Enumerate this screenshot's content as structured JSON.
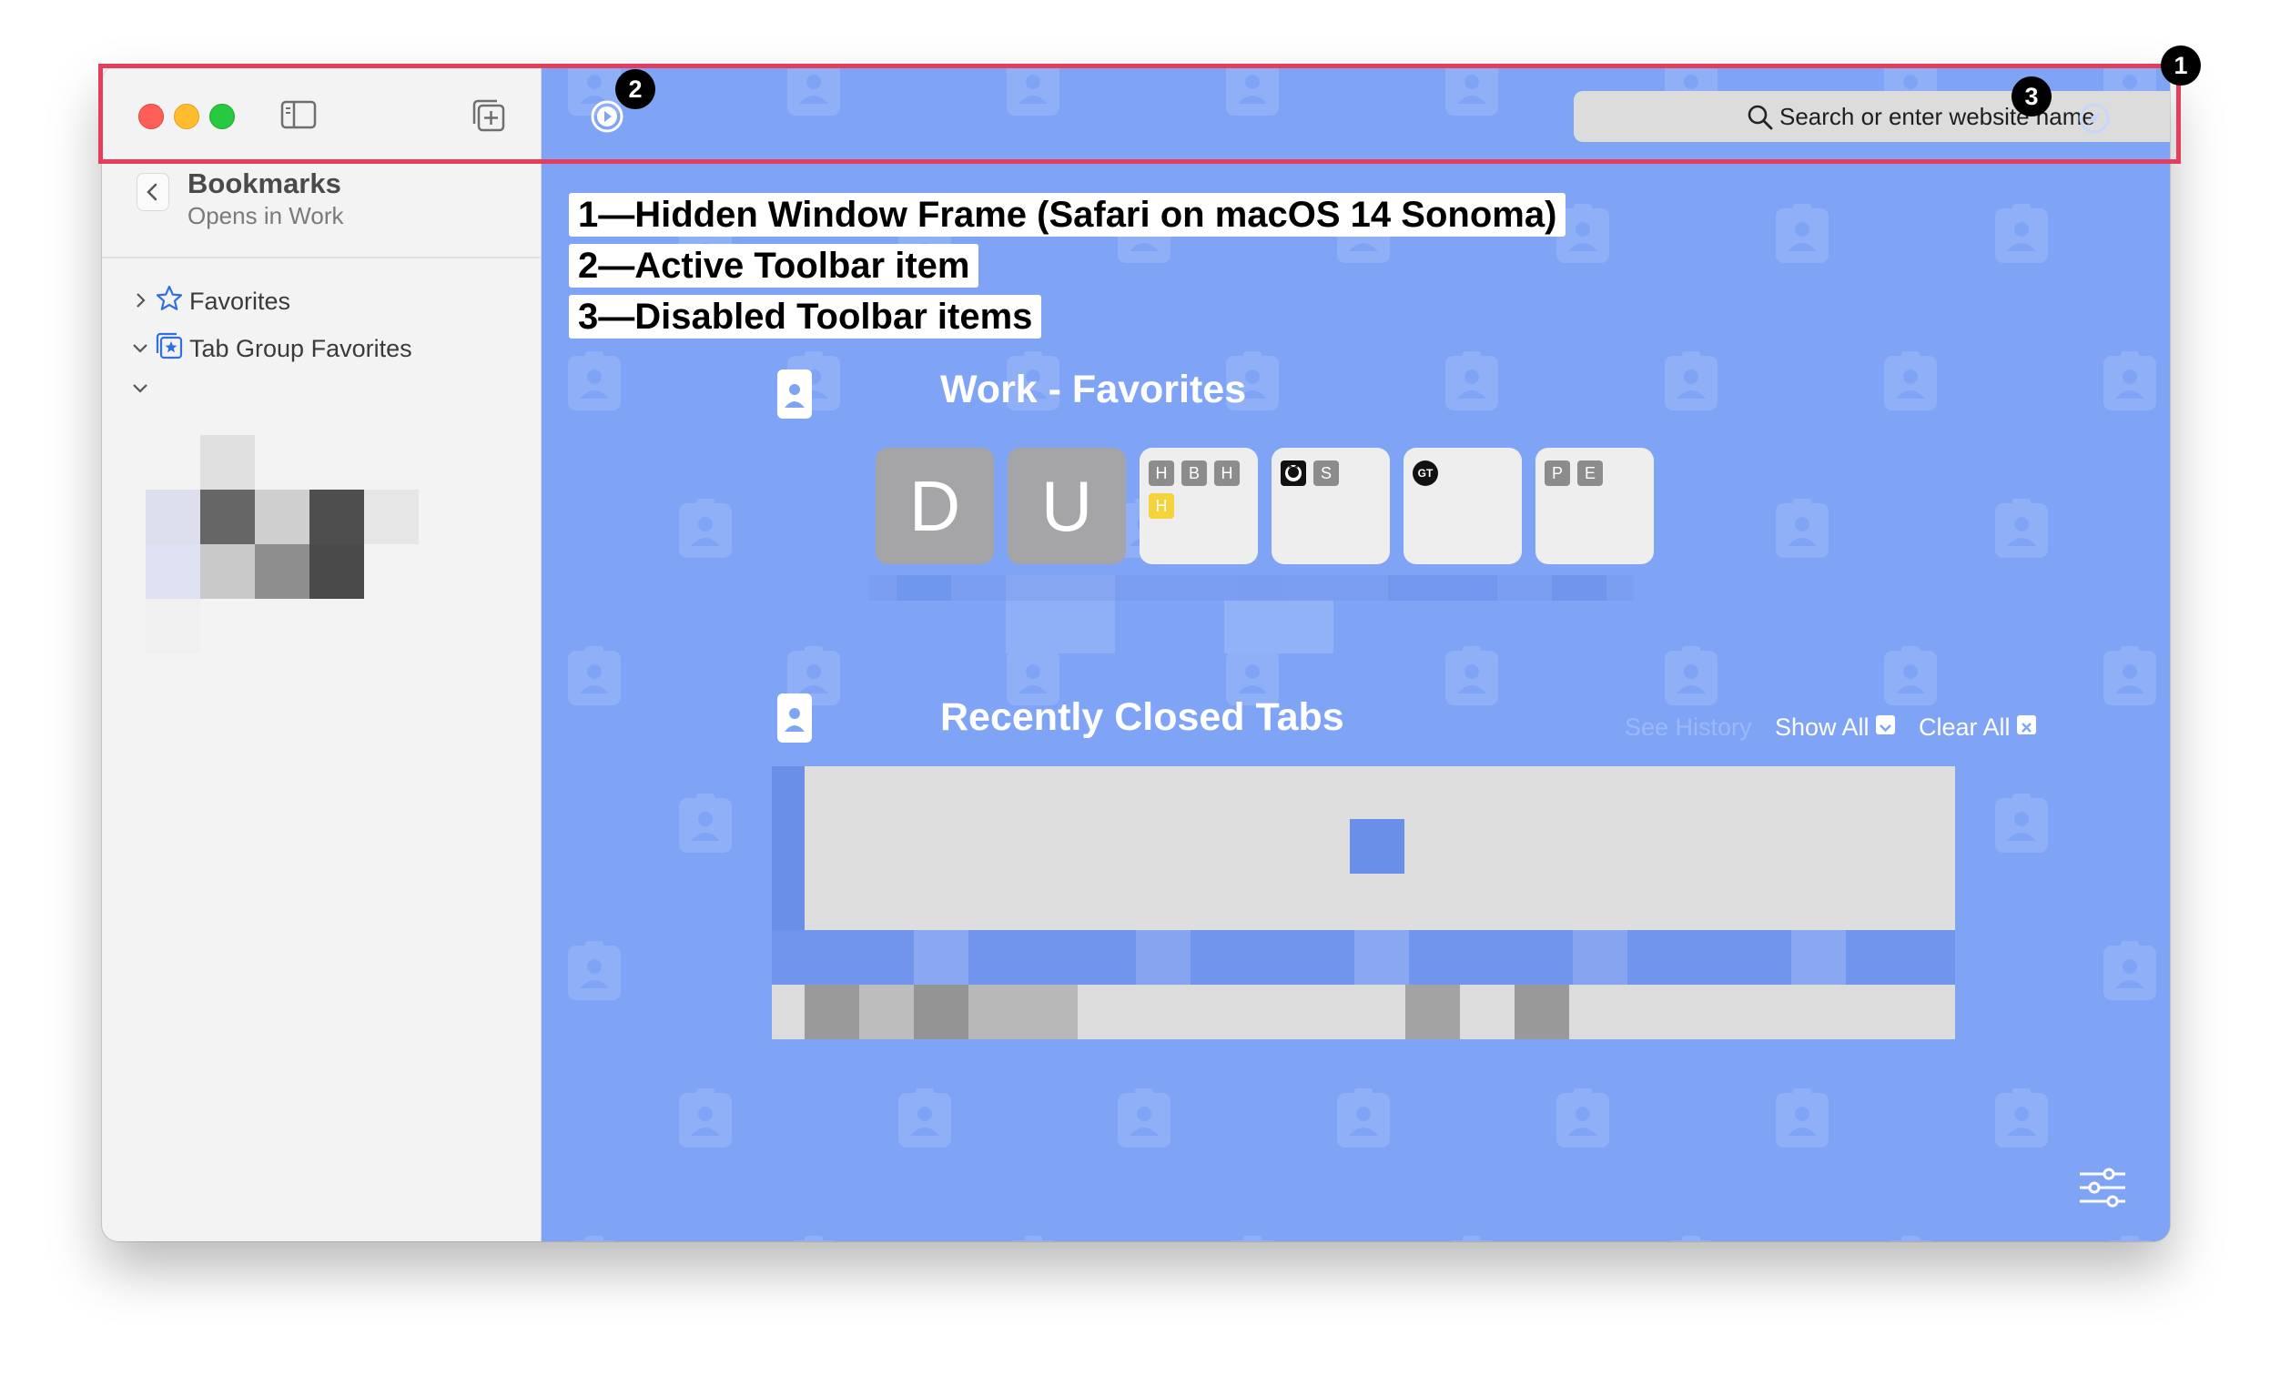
{
  "sidebar": {
    "header": {
      "title": "Bookmarks",
      "subtitle": "Opens in Work"
    },
    "items": [
      {
        "label": "Favorites",
        "icon": "star-icon",
        "expanded": false
      },
      {
        "label": "Tab Group Favorites",
        "icon": "tab-group-star-icon",
        "expanded": true
      }
    ]
  },
  "toolbar": {
    "search_placeholder": "Search or enter website name",
    "active_item_icon": "play-circle-icon",
    "disabled_items": [
      "compass-icon",
      "gear-icon"
    ]
  },
  "annotations": [
    {
      "number": "1",
      "text": "1—Hidden Window Frame (Safari on macOS 14 Sonoma)"
    },
    {
      "number": "2",
      "text": "2—Active Toolbar item"
    },
    {
      "number": "3",
      "text": "3—Disabled Toolbar items"
    }
  ],
  "favorites": {
    "title": "Work - Favorites",
    "tiles": [
      {
        "type": "letter",
        "letter": "D"
      },
      {
        "type": "letter",
        "letter": "U"
      },
      {
        "type": "icons",
        "minis": [
          "H",
          "B",
          "H",
          "H"
        ]
      },
      {
        "type": "icons",
        "minis": [
          "S"
        ],
        "has_github": true
      },
      {
        "type": "icons",
        "minis": [
          "GT"
        ]
      },
      {
        "type": "icons",
        "minis": [
          "P",
          "E"
        ]
      }
    ]
  },
  "recently_closed": {
    "title": "Recently Closed Tabs",
    "see_history": "See History",
    "show_all": "Show All",
    "clear_all": "Clear All"
  },
  "colors": {
    "accent": "#7fa4f6",
    "highlight": "#e53e5c",
    "sidebar_bg": "#f3f3f3"
  }
}
